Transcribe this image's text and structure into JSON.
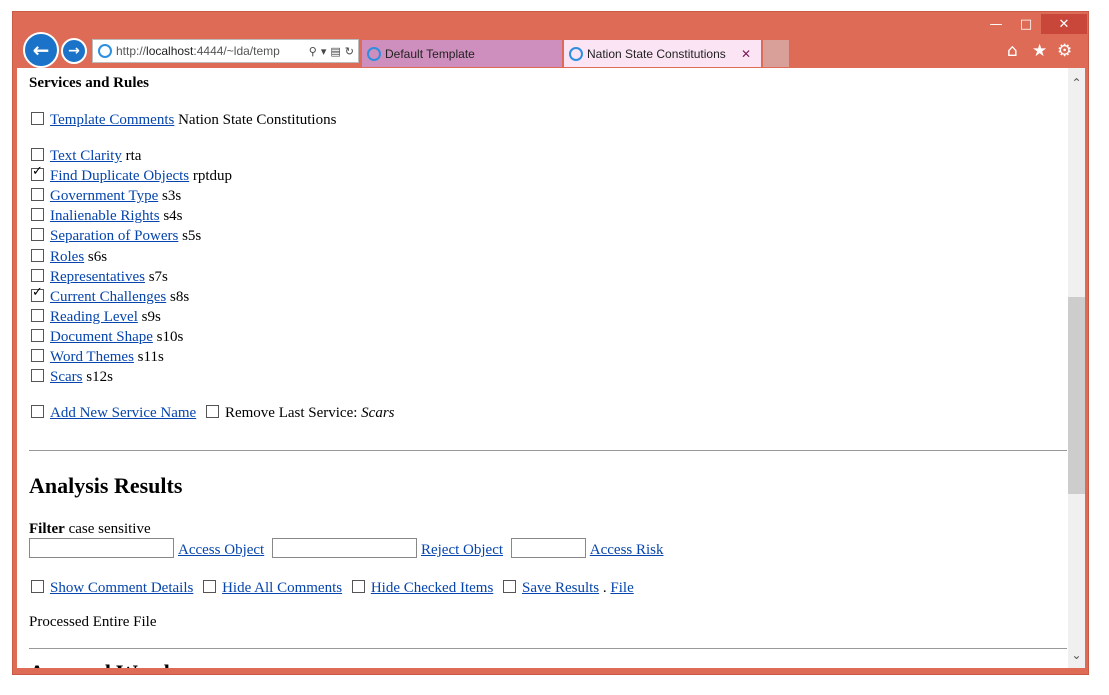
{
  "browser": {
    "url_prefix": "http://",
    "url_host": "localhost",
    "url_rest": ":4444/~lda/temp",
    "tabs": [
      {
        "label": "Default Template"
      },
      {
        "label": "Nation State Constitutions"
      }
    ]
  },
  "services": {
    "heading": "Services and Rules",
    "template": {
      "link": "Template Comments",
      "suffix": "Nation State Constitutions",
      "checked": false
    },
    "items": [
      {
        "link": "Text Clarity",
        "code": "rta",
        "checked": false
      },
      {
        "link": "Find Duplicate Objects",
        "code": "rptdup",
        "checked": true
      },
      {
        "link": "Government Type",
        "code": "s3s",
        "checked": false
      },
      {
        "link": "Inalienable Rights",
        "code": "s4s",
        "checked": false
      },
      {
        "link": "Separation of Powers",
        "code": "s5s",
        "checked": false
      },
      {
        "link": "Roles",
        "code": "s6s",
        "checked": false
      },
      {
        "link": "Representatives",
        "code": "s7s",
        "checked": false
      },
      {
        "link": "Current Challenges",
        "code": "s8s",
        "checked": true
      },
      {
        "link": "Reading Level",
        "code": "s9s",
        "checked": false
      },
      {
        "link": "Document Shape",
        "code": "s10s",
        "checked": false
      },
      {
        "link": "Word Themes",
        "code": "s11s",
        "checked": false
      },
      {
        "link": "Scars",
        "code": "s12s",
        "checked": false
      }
    ],
    "add_new": "Add New Service Name",
    "remove_last_label": "Remove Last Service:",
    "remove_last_name": "Scars"
  },
  "analysis": {
    "heading": "Analysis Results",
    "filter_label": "Filter",
    "filter_note": "case sensitive",
    "access_object": "Access Object",
    "reject_object": "Reject Object",
    "access_risk": "Access Risk",
    "show_comment_details": "Show Comment Details",
    "hide_all_comments": "Hide All Comments",
    "hide_checked_items": "Hide Checked Items",
    "save_results": "Save Results",
    "separator": ".",
    "file": "File",
    "status": "Processed Entire File",
    "next_heading_partial": "Assessed Words"
  }
}
